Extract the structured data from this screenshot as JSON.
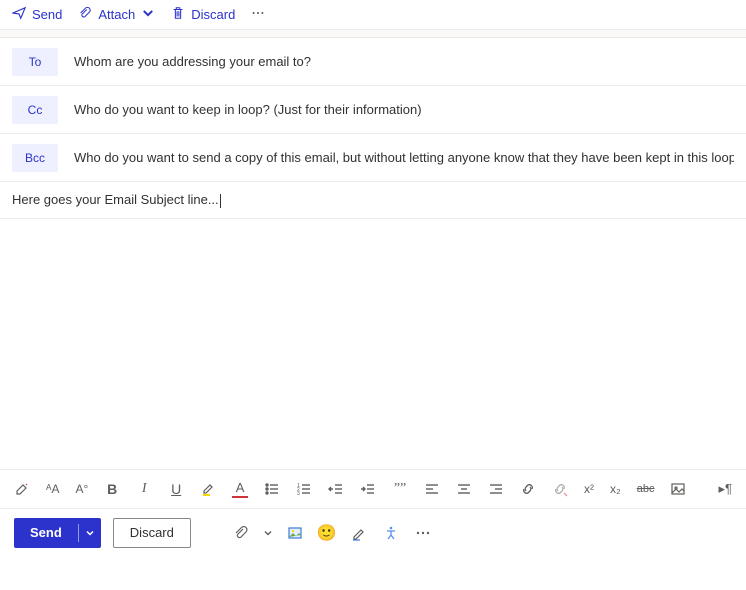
{
  "toolbar": {
    "send_label": "Send",
    "attach_label": "Attach",
    "discard_label": "Discard"
  },
  "recipients": {
    "to": {
      "label": "To",
      "placeholder": "Whom are you addressing your email to?"
    },
    "cc": {
      "label": "Cc",
      "placeholder": "Who do you want to keep in loop? (Just for their information)"
    },
    "bcc": {
      "label": "Bcc",
      "placeholder": "Who do you want to send a copy of this email, but without letting anyone know that they have been kept in this loop?"
    }
  },
  "subject": {
    "value": "Here goes your Email Subject line..."
  },
  "format_icons": {
    "paint_format": "paint-format",
    "font_case": "ᴬA",
    "font_size": "Aᵒ",
    "bold": "B",
    "italic": "I",
    "underline": "U",
    "highlight": "highlight",
    "font_color": "A",
    "bullets": "bullets",
    "numbering": "numbering",
    "outdent": "outdent",
    "indent": "indent",
    "quote": "”",
    "align_left": "align-left",
    "align_center": "align-center",
    "align_right": "align-right",
    "link": "link",
    "unlink": "unlink",
    "superscript": "x²",
    "subscript": "x₂",
    "strikethrough": "abc",
    "insert_picture": "picture",
    "paragraph_marks": "¶"
  },
  "actions": {
    "send_label": "Send",
    "discard_label": "Discard"
  }
}
